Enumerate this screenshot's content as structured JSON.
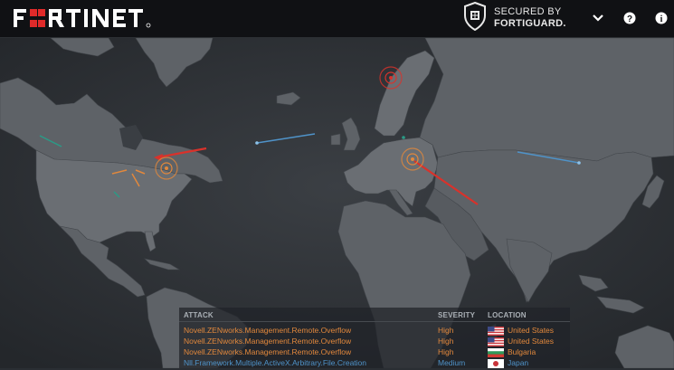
{
  "header": {
    "brand": "FORTINET",
    "secured_line1": "SECURED BY",
    "secured_line2": "FORTIGUARD."
  },
  "feed": {
    "columns": {
      "attack": "ATTACK",
      "severity": "SEVERITY",
      "location": "LOCATION"
    },
    "rows": [
      {
        "attack": "Novell.ZENworks.Management.Remote.Overflow",
        "severity": "High",
        "location": "United States",
        "flag": "us",
        "color": "#e2883c"
      },
      {
        "attack": "Novell.ZENworks.Management.Remote.Overflow",
        "severity": "High",
        "location": "United States",
        "flag": "us",
        "color": "#e2883c"
      },
      {
        "attack": "Novell.ZENworks.Management.Remote.Overflow",
        "severity": "High",
        "location": "Bulgaria",
        "flag": "bg",
        "color": "#e2883c"
      },
      {
        "attack": "Nll.Framework.Multiple.ActiveX.Arbitrary.File.Creation",
        "severity": "Medium",
        "location": "Japan",
        "flag": "jp",
        "color": "#4f93c9"
      }
    ]
  },
  "colors": {
    "high": "#e2883c",
    "medium": "#4f93c9",
    "attack_red": "#d9322b",
    "land": "#5f6368",
    "ocean": "#2a2e33"
  },
  "icons": [
    "fortiguard-shield-icon",
    "chevron-down-icon",
    "help-icon",
    "info-icon"
  ]
}
